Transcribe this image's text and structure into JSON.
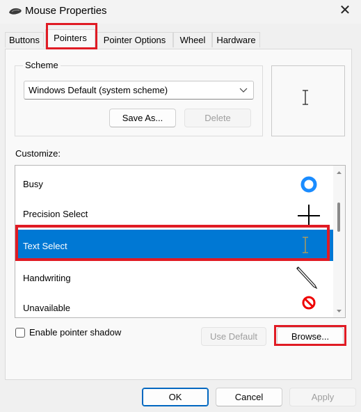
{
  "window": {
    "title": "Mouse Properties",
    "icon": "mouse-icon",
    "close_glyph": "✕"
  },
  "tabs": [
    {
      "label": "Buttons",
      "active": false
    },
    {
      "label": "Pointers",
      "active": true
    },
    {
      "label": "Pointer Options",
      "active": false
    },
    {
      "label": "Wheel",
      "active": false
    },
    {
      "label": "Hardware",
      "active": false
    }
  ],
  "scheme": {
    "group_label": "Scheme",
    "selected_value": "Windows Default (system scheme)",
    "save_as_label": "Save As...",
    "delete_label": "Delete"
  },
  "customize": {
    "label": "Customize:",
    "items": [
      {
        "label": "Busy",
        "icon": "busy-ring-icon"
      },
      {
        "label": "Precision Select",
        "icon": "crosshair-icon"
      },
      {
        "label": "Text Select",
        "icon": "text-beam-icon",
        "selected": true
      },
      {
        "label": "Handwriting",
        "icon": "pen-icon"
      },
      {
        "label": "Unavailable",
        "icon": "unavailable-icon"
      }
    ]
  },
  "options": {
    "shadow_label": "Enable pointer shadow",
    "shadow_checked": false,
    "use_default_label": "Use Default",
    "browse_label": "Browse..."
  },
  "footer": {
    "ok_label": "OK",
    "cancel_label": "Cancel",
    "apply_label": "Apply"
  },
  "colors": {
    "accent": "#0078d4",
    "highlight_annotation": "#e01b24"
  }
}
